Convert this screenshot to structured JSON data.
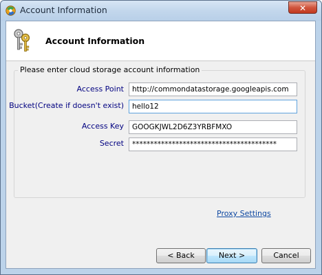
{
  "window": {
    "title": "Account Information",
    "close_label": "✕"
  },
  "header": {
    "title": "Account Information",
    "icon": "keys-icon"
  },
  "form": {
    "group_title": "Please enter cloud storage account information",
    "fields": [
      {
        "label": "Access Point",
        "value": "http://commondatastorage.googleapis.com"
      },
      {
        "label": "Bucket(Create if doesn't exist)",
        "value": "hello12"
      },
      {
        "label": "Access Key",
        "value": "GOOGKJWL2D6Z3YRBFMXO"
      },
      {
        "label": "Secret",
        "value": "****************************************"
      }
    ]
  },
  "links": {
    "proxy_settings": "Proxy Settings"
  },
  "buttons": {
    "back": "< Back",
    "next": "Next >",
    "cancel": "Cancel"
  },
  "colors": {
    "label_text": "#000080",
    "link": "#0d47a1",
    "focus_border": "#5fa2dd"
  }
}
